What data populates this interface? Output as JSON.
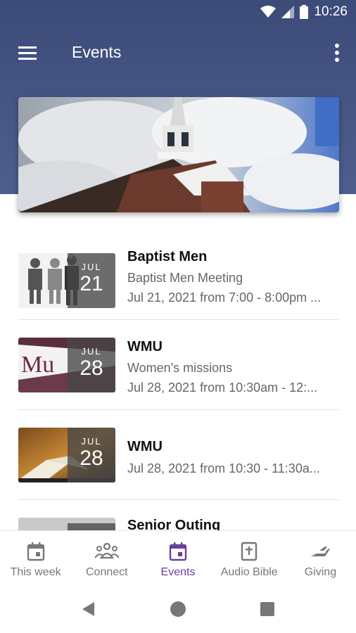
{
  "status_bar": {
    "time": "10:26"
  },
  "app_bar": {
    "title": "Events"
  },
  "events": [
    {
      "title": "Baptist Men",
      "lines": [
        "Baptist Men Meeting",
        "Jul 21, 2021 from 7:00 - 8:00pm ..."
      ],
      "month": "JUL",
      "day": "21"
    },
    {
      "title": "WMU",
      "lines": [
        "Women's missions",
        "Jul 28, 2021 from 10:30am - 12:..."
      ],
      "month": "JUL",
      "day": "28"
    },
    {
      "title": "WMU",
      "lines": [
        "Jul 28, 2021 from 10:30 - 11:30a..."
      ],
      "month": "JUL",
      "day": "28"
    },
    {
      "title": "Senior Outing",
      "lines": [],
      "month": "",
      "day": ""
    }
  ],
  "thumb_text": {
    "wmu_logo": "Mu"
  },
  "bottom_nav": {
    "items": [
      {
        "label": "This week",
        "icon": "calendar-icon"
      },
      {
        "label": "Connect",
        "icon": "people-icon"
      },
      {
        "label": "Events",
        "icon": "calendar-icon",
        "active": true
      },
      {
        "label": "Audio Bible",
        "icon": "bible-icon"
      },
      {
        "label": "Giving",
        "icon": "giving-hand-icon"
      }
    ]
  },
  "colors": {
    "header": "#46558a",
    "active": "#6b3fa0",
    "inactive": "#777777"
  }
}
